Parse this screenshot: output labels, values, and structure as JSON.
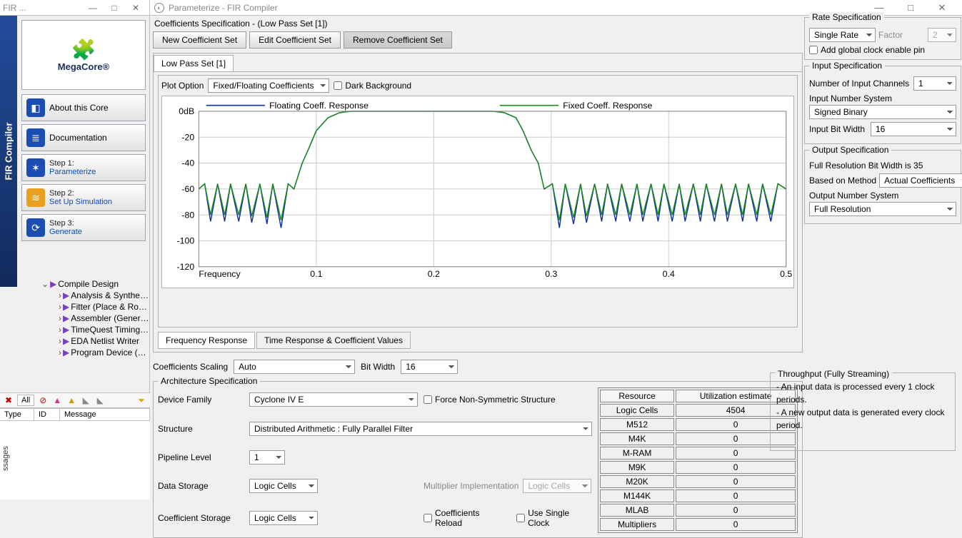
{
  "left_window": {
    "title": "FIR ...",
    "strip_label": "FIR Compiler",
    "logo_text": "MegaCore®",
    "btn_about": "About this Core",
    "btn_doc": "Documentation",
    "step1_label": "Step 1:",
    "step1_link": "Parameterize",
    "step2_label": "Step 2:",
    "step2_link": "Set Up Simulation",
    "step3_label": "Step 3:",
    "step3_link": "Generate",
    "tree": {
      "root": "Compile Design",
      "items": [
        "Analysis & Synthesis",
        "Fitter (Place & Route",
        "Assembler (Generate",
        "TimeQuest Timing An",
        "EDA Netlist Writer",
        "Program Device (Open P"
      ]
    },
    "msg_all": "All",
    "msg_cols": {
      "type": "Type",
      "id": "ID",
      "message": "Message"
    },
    "msg_tab": "ssages"
  },
  "dialog": {
    "title": "Parameterize - FIR Compiler",
    "coeff_spec_title": "Coefficients Specification - (Low Pass Set [1])",
    "btn_new": "New Coefficient Set",
    "btn_edit": "Edit Coefficient Set",
    "btn_remove": "Remove Coefficient Set",
    "tab_lowpass": "Low Pass Set [1]",
    "plot_option_label": "Plot Option",
    "plot_option_value": "Fixed/Floating Coefficients",
    "dark_bg_label": "Dark Background",
    "legend_floating": "Floating Coeff. Response",
    "legend_fixed": "Fixed Coeff. Response",
    "xlabel": "Frequency",
    "tab_freq": "Frequency Response",
    "tab_time": "Time Response & Coefficient Values",
    "scaling_label": "Coefficients Scaling",
    "scaling_value": "Auto",
    "bitwidth_label": "Bit Width",
    "bitwidth_value": "16"
  },
  "arch": {
    "title": "Architecture Specification",
    "device_family_label": "Device Family",
    "device_family_value": "Cyclone IV E",
    "force_nonsym_label": "Force Non-Symmetric Structure",
    "structure_label": "Structure",
    "structure_value": "Distributed Arithmetic : Fully Parallel Filter",
    "pipeline_label": "Pipeline Level",
    "pipeline_value": "1",
    "data_storage_label": "Data Storage",
    "data_storage_value": "Logic Cells",
    "mult_impl_label": "Multiplier Implementation",
    "mult_impl_value": "Logic Cells",
    "coeff_storage_label": "Coefficient Storage",
    "coeff_storage_value": "Logic Cells",
    "coeff_reload_label": "Coefficients Reload",
    "single_clock_label": "Use Single Clock",
    "res_hdr_resource": "Resource",
    "res_hdr_util": "Utilization estimate",
    "resources": [
      {
        "name": "Logic Cells",
        "value": "4504"
      },
      {
        "name": "M512",
        "value": "0"
      },
      {
        "name": "M4K",
        "value": "0"
      },
      {
        "name": "M-RAM",
        "value": "0"
      },
      {
        "name": "M9K",
        "value": "0"
      },
      {
        "name": "M20K",
        "value": "0"
      },
      {
        "name": "M144K",
        "value": "0"
      },
      {
        "name": "MLAB",
        "value": "0"
      },
      {
        "name": "Multipliers",
        "value": "0"
      }
    ]
  },
  "right": {
    "rate_title": "Rate Specification",
    "rate_value": "Single Rate",
    "factor_label": "Factor",
    "factor_value": "2",
    "add_global_clock_label": "Add global clock enable pin",
    "input_spec_title": "Input Specification",
    "num_channels_label": "Number of Input Channels",
    "num_channels_value": "1",
    "input_num_sys_label": "Input Number System",
    "input_num_sys_value": "Signed Binary",
    "input_bit_width_label": "Input Bit Width",
    "input_bit_width_value": "16",
    "output_spec_title": "Output Specification",
    "full_res_text": "Full Resolution Bit Width is 35",
    "based_on_label": "Based on Method",
    "based_on_value": "Actual Coefficients",
    "output_num_sys_label": "Output Number System",
    "output_num_sys_value": "Full Resolution"
  },
  "throughput": {
    "title": "Throughput (Fully Streaming)",
    "line1": "- An input data is processed every 1 clock periods.",
    "line2": "- A new output data is generated every clock period."
  },
  "chart_data": {
    "type": "line",
    "xlabel": "Frequency",
    "ylabel": "dB",
    "xlim": [
      0,
      0.5
    ],
    "ylim": [
      -120,
      0
    ],
    "xticks": [
      0.1,
      0.2,
      0.3,
      0.4,
      0.5
    ],
    "yticks": [
      0,
      -20,
      -40,
      -60,
      -80,
      -100,
      -120
    ],
    "ytick_labels": [
      "0dB",
      "-20",
      "-40",
      "-60",
      "-80",
      "-100",
      "-120"
    ],
    "series": [
      {
        "name": "Floating Coeff. Response",
        "color": "#1030a0",
        "x": [
          0,
          0.005,
          0.01,
          0.016,
          0.022,
          0.027,
          0.034,
          0.04,
          0.045,
          0.052,
          0.058,
          0.063,
          0.07,
          0.076,
          0.081,
          0.088,
          0.093,
          0.1,
          0.11,
          0.12,
          0.13,
          0.14,
          0.15,
          0.16,
          0.17,
          0.18,
          0.19,
          0.2,
          0.21,
          0.22,
          0.23,
          0.24,
          0.25,
          0.26,
          0.27,
          0.276,
          0.283,
          0.289,
          0.294,
          0.301,
          0.307,
          0.312,
          0.319,
          0.325,
          0.33,
          0.337,
          0.343,
          0.348,
          0.355,
          0.36,
          0.367,
          0.373,
          0.378,
          0.385,
          0.391,
          0.396,
          0.403,
          0.409,
          0.414,
          0.421,
          0.427,
          0.432,
          0.439,
          0.445,
          0.45,
          0.457,
          0.463,
          0.468,
          0.475,
          0.48,
          0.487,
          0.493,
          0.5
        ],
        "y": [
          -60,
          -56,
          -85,
          -56,
          -85,
          -56,
          -85,
          -56,
          -86,
          -56,
          -87,
          -56,
          -90,
          -56,
          -60,
          -40,
          -30,
          -15,
          -5,
          -1,
          0,
          0,
          0,
          0,
          0,
          0,
          0,
          0,
          0,
          0,
          0,
          0,
          0,
          -1,
          -5,
          -15,
          -30,
          -40,
          -60,
          -56,
          -90,
          -56,
          -87,
          -56,
          -86,
          -56,
          -85,
          -56,
          -85,
          -56,
          -85,
          -56,
          -85,
          -56,
          -85,
          -56,
          -85,
          -56,
          -85,
          -56,
          -85,
          -56,
          -85,
          -56,
          -85,
          -56,
          -85,
          -56,
          -85,
          -56,
          -85,
          -56,
          -60
        ]
      },
      {
        "name": "Fixed Coeff. Response",
        "color": "#1a8a1a",
        "x": [
          0,
          0.005,
          0.01,
          0.016,
          0.022,
          0.027,
          0.034,
          0.04,
          0.045,
          0.052,
          0.058,
          0.063,
          0.07,
          0.076,
          0.081,
          0.088,
          0.093,
          0.1,
          0.11,
          0.12,
          0.13,
          0.14,
          0.15,
          0.16,
          0.17,
          0.18,
          0.19,
          0.2,
          0.21,
          0.22,
          0.23,
          0.24,
          0.25,
          0.26,
          0.27,
          0.276,
          0.283,
          0.289,
          0.294,
          0.301,
          0.307,
          0.312,
          0.319,
          0.325,
          0.33,
          0.337,
          0.343,
          0.348,
          0.355,
          0.36,
          0.367,
          0.373,
          0.378,
          0.385,
          0.391,
          0.396,
          0.403,
          0.409,
          0.414,
          0.421,
          0.427,
          0.432,
          0.439,
          0.445,
          0.45,
          0.457,
          0.463,
          0.468,
          0.475,
          0.48,
          0.487,
          0.493,
          0.5
        ],
        "y": [
          -60,
          -56,
          -80,
          -56,
          -80,
          -56,
          -80,
          -56,
          -81,
          -56,
          -82,
          -56,
          -84,
          -56,
          -60,
          -40,
          -30,
          -15,
          -5,
          -1,
          0,
          0,
          0,
          0,
          0,
          0,
          0,
          0,
          0,
          0,
          0,
          0,
          0,
          -1,
          -5,
          -15,
          -30,
          -40,
          -60,
          -56,
          -84,
          -56,
          -82,
          -56,
          -81,
          -56,
          -80,
          -56,
          -80,
          -56,
          -80,
          -56,
          -80,
          -56,
          -80,
          -56,
          -80,
          -56,
          -80,
          -56,
          -80,
          -56,
          -80,
          -56,
          -80,
          -56,
          -80,
          -56,
          -80,
          -56,
          -80,
          -56,
          -60
        ]
      }
    ]
  }
}
